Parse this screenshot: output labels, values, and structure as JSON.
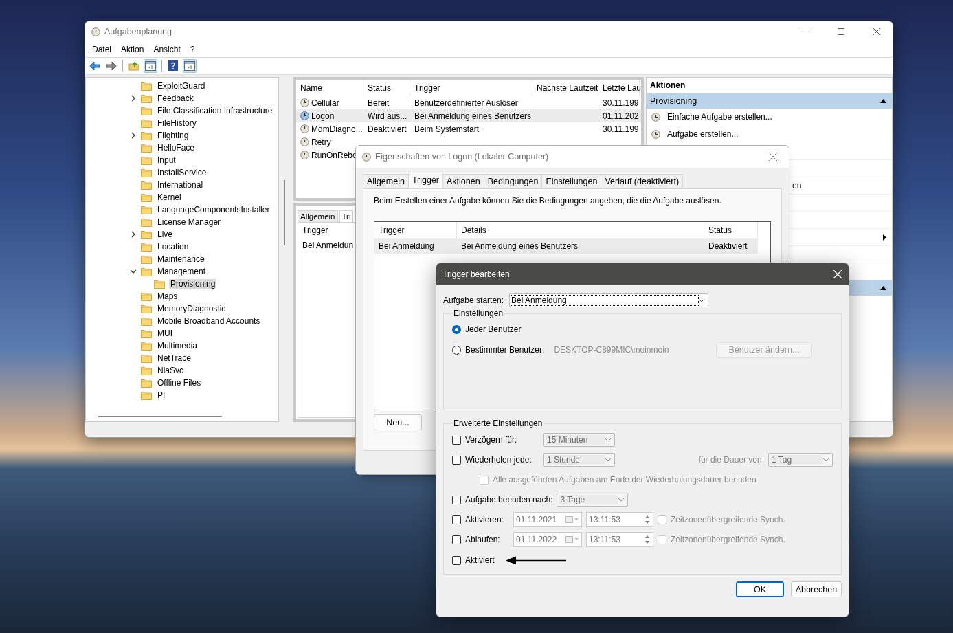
{
  "main_window": {
    "title": "Aufgabenplanung",
    "menu": [
      "Datei",
      "Aktion",
      "Ansicht",
      "?"
    ],
    "tree": [
      {
        "label": "ExploitGuard",
        "expandable": false,
        "selected": false
      },
      {
        "label": "Feedback",
        "expandable": true,
        "expanded": false,
        "selected": false
      },
      {
        "label": "File Classification Infrastructure",
        "expandable": false,
        "selected": false
      },
      {
        "label": "FileHistory",
        "expandable": false,
        "selected": false
      },
      {
        "label": "Flighting",
        "expandable": true,
        "expanded": false,
        "selected": false
      },
      {
        "label": "HelloFace",
        "expandable": false,
        "selected": false
      },
      {
        "label": "Input",
        "expandable": false,
        "selected": false
      },
      {
        "label": "InstallService",
        "expandable": false,
        "selected": false
      },
      {
        "label": "International",
        "expandable": false,
        "selected": false
      },
      {
        "label": "Kernel",
        "expandable": false,
        "selected": false
      },
      {
        "label": "LanguageComponentsInstaller",
        "expandable": false,
        "selected": false
      },
      {
        "label": "License Manager",
        "expandable": false,
        "selected": false
      },
      {
        "label": "Live",
        "expandable": true,
        "expanded": false,
        "selected": false
      },
      {
        "label": "Location",
        "expandable": false,
        "selected": false
      },
      {
        "label": "Maintenance",
        "expandable": false,
        "selected": false
      },
      {
        "label": "Management",
        "expandable": true,
        "expanded": true,
        "selected": false,
        "children": [
          {
            "label": "Provisioning",
            "expandable": false,
            "selected": true
          }
        ]
      },
      {
        "label": "Maps",
        "expandable": false,
        "selected": false
      },
      {
        "label": "MemoryDiagnostic",
        "expandable": false,
        "selected": false
      },
      {
        "label": "Mobile Broadband Accounts",
        "expandable": false,
        "selected": false
      },
      {
        "label": "MUI",
        "expandable": false,
        "selected": false
      },
      {
        "label": "Multimedia",
        "expandable": false,
        "selected": false
      },
      {
        "label": "NetTrace",
        "expandable": false,
        "selected": false
      },
      {
        "label": "NlaSvc",
        "expandable": false,
        "selected": false
      },
      {
        "label": "Offline Files",
        "expandable": false,
        "selected": false
      },
      {
        "label": "PI",
        "expandable": false,
        "selected": false
      }
    ],
    "tasks": {
      "columns": [
        "Name",
        "Status",
        "Trigger",
        "Nächste Laufzeit",
        "Letzte Lau"
      ],
      "rows": [
        {
          "cells": [
            "Cellular",
            "Bereit",
            "Benutzerdefinierter Auslöser",
            "",
            "30.11.199"
          ],
          "running": false,
          "selected": false
        },
        {
          "cells": [
            "Logon",
            "Wird aus...",
            "Bei Anmeldung eines Benutzers",
            "",
            "01.11.202"
          ],
          "running": true,
          "selected": true
        },
        {
          "cells": [
            "MdmDiagno...",
            "Deaktiviert",
            "Beim Systemstart",
            "",
            "30.11.199"
          ],
          "running": false,
          "selected": false
        },
        {
          "cells": [
            "Retry"
          ],
          "running": false,
          "selected": false
        },
        {
          "cells": [
            "RunOnRebo"
          ],
          "running": false,
          "selected": false
        }
      ]
    },
    "detail": {
      "tabs": [
        {
          "label": "Allgemein",
          "selected": false
        },
        {
          "label": "Tri",
          "selected": true
        }
      ],
      "column": "Trigger",
      "rows": [
        "Bei Anmeldun"
      ]
    },
    "actions": {
      "title": "Aktionen",
      "sections": [
        {
          "title": "Provisioning",
          "expanded": true,
          "items": [
            {
              "kind": "action",
              "label": "Einfache Aufgabe erstellen..."
            },
            {
              "kind": "action",
              "label": "Aufgabe erstellen..."
            },
            {
              "kind": "covered"
            },
            {
              "kind": "covered"
            },
            {
              "kind": "text",
              "label": "en"
            },
            {
              "kind": "covered"
            },
            {
              "kind": "covered"
            },
            {
              "kind": "submenu"
            },
            {
              "kind": "covered"
            },
            {
              "kind": "covered"
            }
          ]
        },
        {
          "expanded": true
        }
      ]
    }
  },
  "properties_dialog": {
    "title": "Eigenschaften von Logon (Lokaler Computer)",
    "tabs": [
      {
        "label": "Allgemein",
        "selected": false
      },
      {
        "label": "Trigger",
        "selected": true
      },
      {
        "label": "Aktionen",
        "selected": false
      },
      {
        "label": "Bedingungen",
        "selected": false
      },
      {
        "label": "Einstellungen",
        "selected": false
      },
      {
        "label": "Verlauf (deaktiviert)",
        "selected": false
      }
    ],
    "intro": "Beim Erstellen einer Aufgabe können Sie die Bedingungen angeben, die die Aufgabe auslösen.",
    "columns": [
      "Trigger",
      "Details",
      "Status"
    ],
    "rows": [
      {
        "cells": [
          "Bei Anmeldung",
          "Bei Anmeldung eines Benutzers",
          "Deaktiviert"
        ],
        "selected": true
      }
    ],
    "buttons": [
      "Neu..."
    ]
  },
  "trigger_dialog": {
    "title": "Trigger bearbeiten",
    "start_label": "Aufgabe starten:",
    "start_value": "Bei Anmeldung",
    "settings": {
      "title": "Einstellungen",
      "options": [
        {
          "label": "Jeder Benutzer",
          "selected": true
        },
        {
          "label": "Bestimmter Benutzer:",
          "selected": false,
          "user": "DESKTOP-C899MIC\\moinmoin",
          "button": "Benutzer ändern...",
          "button_disabled": true
        }
      ]
    },
    "advanced": {
      "title": "Erweiterte Einstellungen",
      "rows": [
        {
          "kind": "select",
          "label": "Verzögern für:",
          "checked": false,
          "value": "15 Minuten",
          "disabled": true
        },
        {
          "kind": "repeat",
          "label": "Wiederholen jede:",
          "checked": false,
          "value": "1 Stunde",
          "disabled": true,
          "extra_label": "für die Dauer von:",
          "extra_value": "1 Tag"
        },
        {
          "kind": "sub",
          "label": "Alle ausgeführten Aufgaben am Ende der Wiederholungsdauer beenden",
          "checked": false,
          "disabled": true
        },
        {
          "kind": "select",
          "label": "Aufgabe beenden nach:",
          "checked": false,
          "value": "3 Tage",
          "disabled": true
        },
        {
          "kind": "datetime",
          "label": "Aktivieren:",
          "checked": false,
          "date": "01.11.2021",
          "time": "13:11:53",
          "disabled": true,
          "sync_label": "Zeitzonenübergreifende Synch.",
          "sync_checked": false
        },
        {
          "kind": "datetime",
          "label": "Ablaufen:",
          "checked": false,
          "date": "01.11.2022",
          "time": "13:11:53",
          "disabled": true,
          "sync_label": "Zeitzonenübergreifende Synch.",
          "sync_checked": false
        },
        {
          "kind": "plain",
          "label": "Aktiviert",
          "checked": false,
          "arrow": true
        }
      ]
    },
    "buttons": [
      {
        "label": "OK",
        "default": true
      },
      {
        "label": "Abbrechen",
        "default": false
      }
    ]
  }
}
